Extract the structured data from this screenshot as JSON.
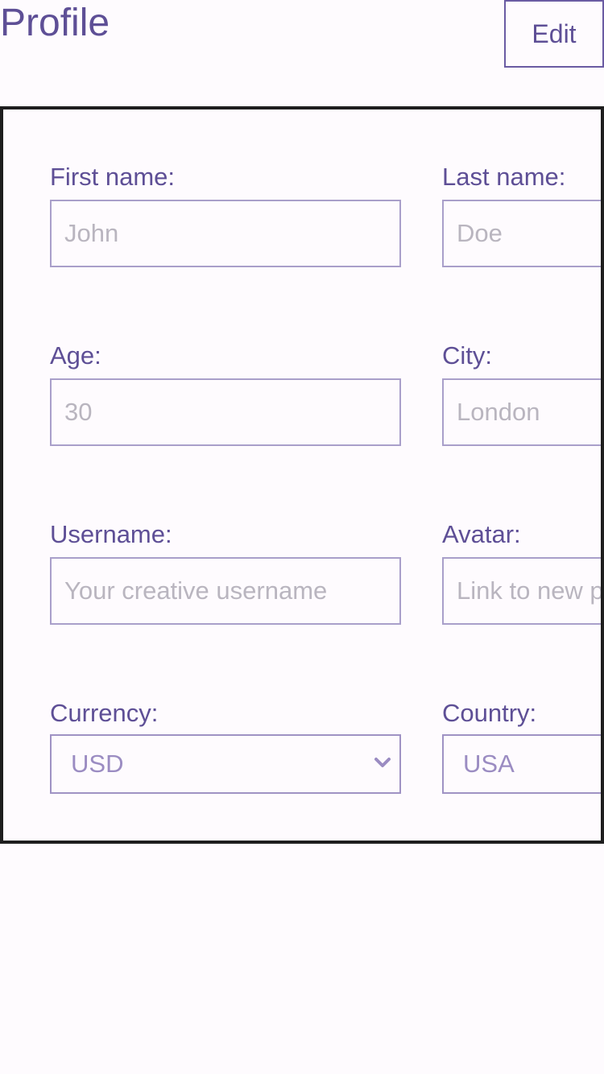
{
  "header": {
    "title": "Profile",
    "edit_label": "Edit"
  },
  "form": {
    "first_name": {
      "label": "First name:",
      "placeholder": "John"
    },
    "last_name": {
      "label": "Last name:",
      "placeholder": "Doe"
    },
    "age": {
      "label": "Age:",
      "placeholder": "30"
    },
    "city": {
      "label": "City:",
      "placeholder": "London"
    },
    "username": {
      "label": "Username:",
      "placeholder": "Your creative username"
    },
    "avatar": {
      "label": "Avatar:",
      "placeholder": "Link to new p"
    },
    "currency": {
      "label": "Currency:",
      "selected": "USD"
    },
    "country": {
      "label": "Country:",
      "selected": "USA"
    }
  },
  "colors": {
    "accent": "#5e4f96",
    "input_border": "#a99fca",
    "placeholder": "#b9b5bf",
    "panel_border": "#1e1e1e",
    "background": "#fefbfe"
  },
  "icons": {
    "select_arrow": "chevron-down-icon"
  }
}
